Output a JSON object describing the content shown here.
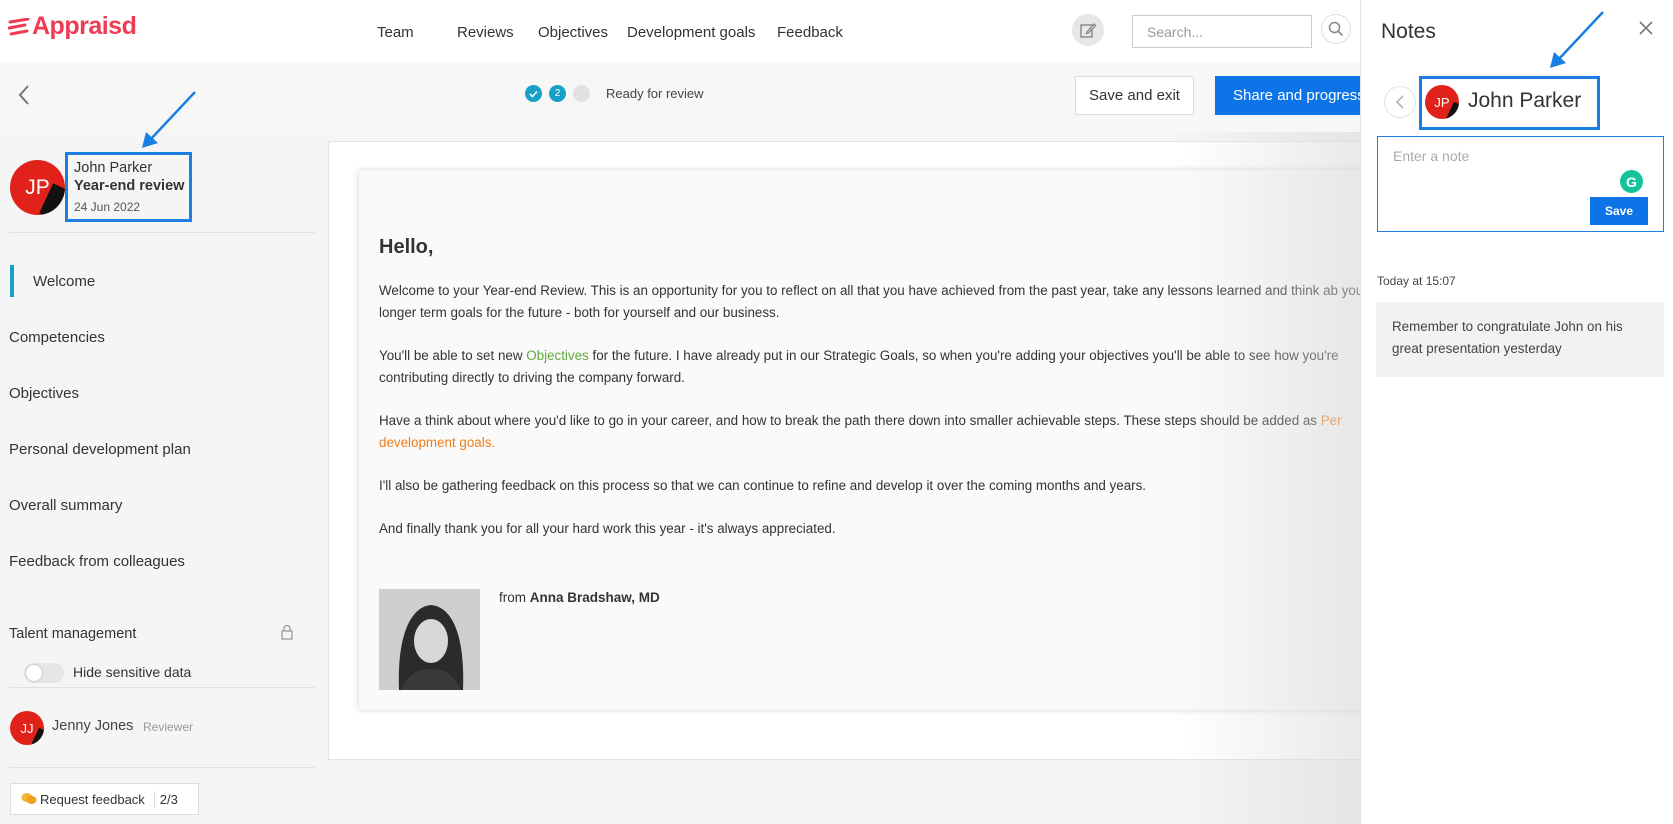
{
  "header": {
    "logo": "Appraisd",
    "nav": [
      "Team",
      "Reviews",
      "Objectives",
      "Development goals",
      "Feedback"
    ],
    "search_placeholder": "Search..."
  },
  "subbar": {
    "step2": "2",
    "status": "Ready for review",
    "save_exit": "Save and exit",
    "share": "Share and progress"
  },
  "review": {
    "avatar_initials": "JP",
    "name": "John Parker",
    "title": "Year-end review",
    "date": "24 Jun 2022"
  },
  "sidebar": {
    "items": [
      "Welcome",
      "Competencies",
      "Objectives",
      "Personal development plan",
      "Overall summary",
      "Feedback from colleagues"
    ],
    "talent": "Talent management",
    "hide_sensitive": "Hide sensitive data",
    "reviewer_initials": "JJ",
    "reviewer_name": "Jenny Jones",
    "reviewer_role": "Reviewer",
    "request_feedback": "Request feedback",
    "feedback_count": "2/3"
  },
  "letter": {
    "greeting": "Hello,",
    "p1": "Welcome to your Year-end Review.  This is an opportunity for you to reflect on all that you have achieved from the past year, take any lessons learned and think ab your longer term goals for the future - both for yourself and our business.",
    "p2_a": "You'll be able to set new ",
    "p2_link": "Objectives",
    "p2_b": " for the future. I have already put in our Strategic Goals, so when you're adding your objectives you'll be able to see how you're contributing directly to driving the company forward.",
    "p3_a": "Have a think about where you'd like to go in your career, and how to break the path there down into smaller achievable steps. These steps should be added as ",
    "p3_link": "Per development goals.",
    "p4": "I'll also be gathering feedback on this process so that we can continue to refine and develop it over the coming months and years.",
    "p5": "And finally thank you for all your hard work this year - it's always appreciated.",
    "from_prefix": "from",
    "from_name": "Anna Bradshaw, MD"
  },
  "notes": {
    "title": "Notes",
    "avatar_initials": "JP",
    "name": "John Parker",
    "placeholder": "Enter a note",
    "save": "Save",
    "time": "Today at 15:07",
    "note_text": "Remember to congratulate John on his great presentation yesterday"
  },
  "colors": {
    "brand": "#ef3b53",
    "primary": "#0d74e7",
    "annotation": "#1a7fe0",
    "avatar": "#e0221b",
    "link_green": "#61a83c",
    "link_orange": "#ef7d1a"
  }
}
